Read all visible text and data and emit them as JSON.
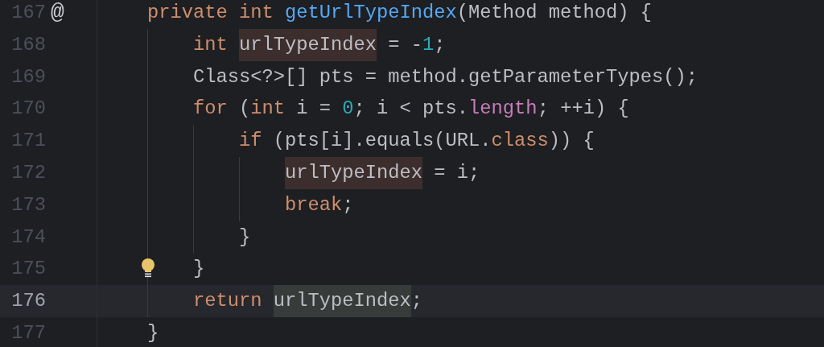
{
  "editor": {
    "lines": [
      {
        "number": "167",
        "current": false,
        "gutter_mark": "@",
        "intention": false,
        "code": [
          {
            "t": "private int ",
            "kind": "keyword"
          },
          {
            "t": "getUrlTypeIndex",
            "kind": "function"
          },
          {
            "t": "(Method method) {",
            "kind": "plain"
          }
        ],
        "children": [
          {
            "number": "168",
            "current": false,
            "intention": false,
            "code": [
              {
                "t": "int ",
                "kind": "keyword"
              },
              {
                "t": "urlTypeIndex",
                "kind": "usage-write"
              },
              {
                "t": " = -",
                "kind": "plain"
              },
              {
                "t": "1",
                "kind": "number"
              },
              {
                "t": ";",
                "kind": "plain"
              }
            ]
          },
          {
            "number": "169",
            "current": false,
            "intention": false,
            "code": [
              {
                "t": "Class<?>[] pts = method.getParameterTypes();",
                "kind": "plain"
              }
            ]
          },
          {
            "number": "170",
            "current": false,
            "intention": false,
            "code": [
              {
                "t": "for ",
                "kind": "keyword"
              },
              {
                "t": "(",
                "kind": "plain"
              },
              {
                "t": "int ",
                "kind": "keyword"
              },
              {
                "t": "i = ",
                "kind": "plain"
              },
              {
                "t": "0",
                "kind": "number"
              },
              {
                "t": "; i < pts.",
                "kind": "plain"
              },
              {
                "t": "length",
                "kind": "field"
              },
              {
                "t": "; ++i) {",
                "kind": "plain"
              }
            ],
            "children": [
              {
                "number": "171",
                "current": false,
                "intention": false,
                "code": [
                  {
                    "t": "if ",
                    "kind": "keyword"
                  },
                  {
                    "t": "(pts[i].equals(URL.",
                    "kind": "plain"
                  },
                  {
                    "t": "class",
                    "kind": "keyword"
                  },
                  {
                    "t": ")) {",
                    "kind": "plain"
                  }
                ],
                "children": [
                  {
                    "number": "172",
                    "current": false,
                    "intention": false,
                    "code": [
                      {
                        "t": "urlTypeIndex",
                        "kind": "usage-write"
                      },
                      {
                        "t": " = i;",
                        "kind": "plain"
                      }
                    ]
                  },
                  {
                    "number": "173",
                    "current": false,
                    "intention": false,
                    "code": [
                      {
                        "t": "break",
                        "kind": "keyword"
                      },
                      {
                        "t": ";",
                        "kind": "plain"
                      }
                    ]
                  }
                ]
              },
              {
                "number": "174",
                "current": false,
                "intention": false,
                "code": [
                  {
                    "t": "}",
                    "kind": "plain"
                  }
                ]
              }
            ]
          },
          {
            "number": "175",
            "current": false,
            "intention": true,
            "code": [
              {
                "t": "}",
                "kind": "plain"
              }
            ]
          },
          {
            "number": "176",
            "current": true,
            "intention": false,
            "code": [
              {
                "t": "return ",
                "kind": "keyword"
              },
              {
                "t": "urlTypeIndex",
                "kind": "usage-read"
              },
              {
                "t": ";",
                "kind": "plain"
              }
            ]
          }
        ]
      },
      {
        "number": "177",
        "current": false,
        "intention": false,
        "code": [
          {
            "t": "}",
            "kind": "plain"
          }
        ]
      }
    ]
  }
}
